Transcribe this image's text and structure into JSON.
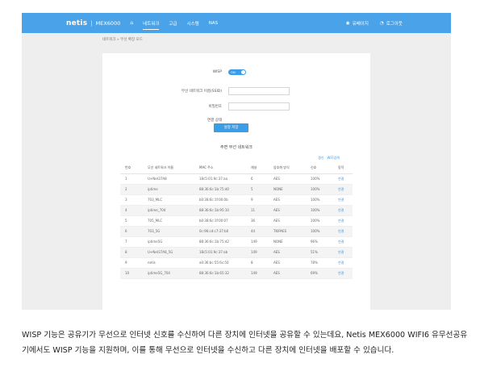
{
  "header": {
    "logo": "netis",
    "separator": "|",
    "model": "MEX6000",
    "home_icon": "home-icon",
    "nav": [
      "네트워크",
      "고급",
      "시스템",
      "NAS"
    ],
    "active_nav": 0,
    "user_icon": "user-icon",
    "user_label": "유배이지",
    "logout_icon": "logout-icon",
    "logout_label": "로그아웃",
    "accent": "#4aa3e8"
  },
  "breadcrumb": "네트워크 » 무선 확장 모드",
  "form": {
    "wisp_label": "WISP",
    "wisp_toggle": "ON",
    "ssid_label": "무선 네트워크 이름(SSID)",
    "ssid_value": "",
    "password_label": "비밀번호",
    "password_value": "",
    "status_label": "연결 상태",
    "status_value": "",
    "save_button": "설정 저장"
  },
  "nearby": {
    "title": "주변 무선 네트워크",
    "refresh": "갱신",
    "wifi_scan": "WiFi검색",
    "columns": [
      "번호",
      "무선 네트워크 이름",
      "MAC 주소",
      "채널",
      "암호화 방식",
      "신호",
      "동작"
    ],
    "rows": [
      [
        "1",
        "U+Net37A8",
        "18c5:01:9c:37:aa",
        "6",
        "AES",
        "100%",
        "연결"
      ],
      [
        "2",
        "iptime",
        "88:36:6c:1b:75:d0",
        "5",
        "NONE",
        "100%",
        "연결"
      ],
      [
        "3",
        "703_MLC",
        "b0:38:6c:1f:00:0b",
        "9",
        "AES",
        "100%",
        "연결"
      ],
      [
        "4",
        "iptime_704",
        "88:36:6c:1b:95:10",
        "11",
        "AES",
        "100%",
        "연결"
      ],
      [
        "5",
        "705_MLC",
        "b0:38:6c:1f:00:07",
        "36",
        "AES",
        "100%",
        "연결"
      ],
      [
        "6",
        "703_5G",
        "0c:96:cd:c7:37:b0",
        "44",
        "TKIPAES",
        "100%",
        "연결"
      ],
      [
        "7",
        "iptime5G",
        "88:36:6c:1b:75:d2",
        "149",
        "NONE",
        "96%",
        "연결"
      ],
      [
        "8",
        "U+Net37A8_5G",
        "18c5:01:9c:37:ab",
        "149",
        "AES",
        "51%",
        "연결"
      ],
      [
        "9",
        "netis",
        "a0:36:bc:55:6c:50",
        "8",
        "AES",
        "78%",
        "연결"
      ],
      [
        "10",
        "iptime5G_704",
        "88:36:6c:1b:65:32",
        "149",
        "AES",
        "69%",
        "연결"
      ]
    ]
  },
  "article": {
    "paragraph": "WISP 기능은 공유기가 무선으로 인터넷 신호를 수신하여 다른 장치에 인터넷을 공유할 수 있는데요, Netis MEX6000 WIFI6 유무선공유기에서도 WISP 기능을 지원하며, 이를 통해 무선으로 인터넷을 수신하고 다른 장치에 인터넷을 배포할 수 있습니다."
  }
}
